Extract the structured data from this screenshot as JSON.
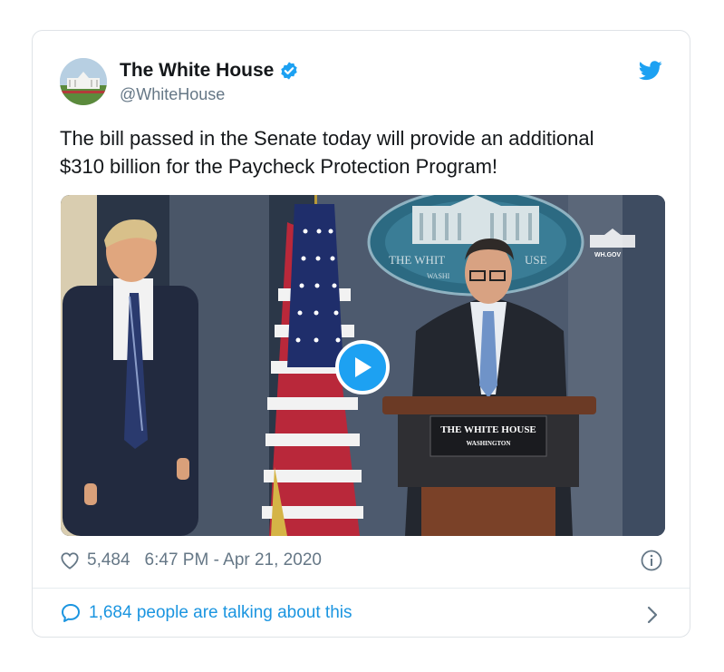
{
  "tweet": {
    "author_name": "The White House",
    "handle": "@WhiteHouse",
    "text": "The bill passed in the Senate today will provide an additional\n$310 billion for the Paycheck Protection Program!",
    "likes": "5,484",
    "timestamp": "6:47 PM - Apr 21, 2020",
    "talking": "1,684 people are talking about this"
  },
  "media": {
    "seal_text_left": "THE WHIT",
    "seal_text_right": "USE",
    "seal_text_bottom": "WASHI",
    "watermark": "WH.GOV",
    "podium_line1": "THE WHITE HOUSE",
    "podium_line2": "WASHINGTON"
  },
  "icons": {
    "verified": "verified-badge-icon",
    "brand": "twitter-bird-icon",
    "like": "heart-icon",
    "info": "info-icon",
    "reply": "speech-bubble-icon",
    "more": "chevron-right-icon",
    "play": "play-icon"
  },
  "colors": {
    "brand_blue": "#1da1f2",
    "link_blue": "#1b95e0",
    "muted": "#657786",
    "text": "#14171a"
  }
}
